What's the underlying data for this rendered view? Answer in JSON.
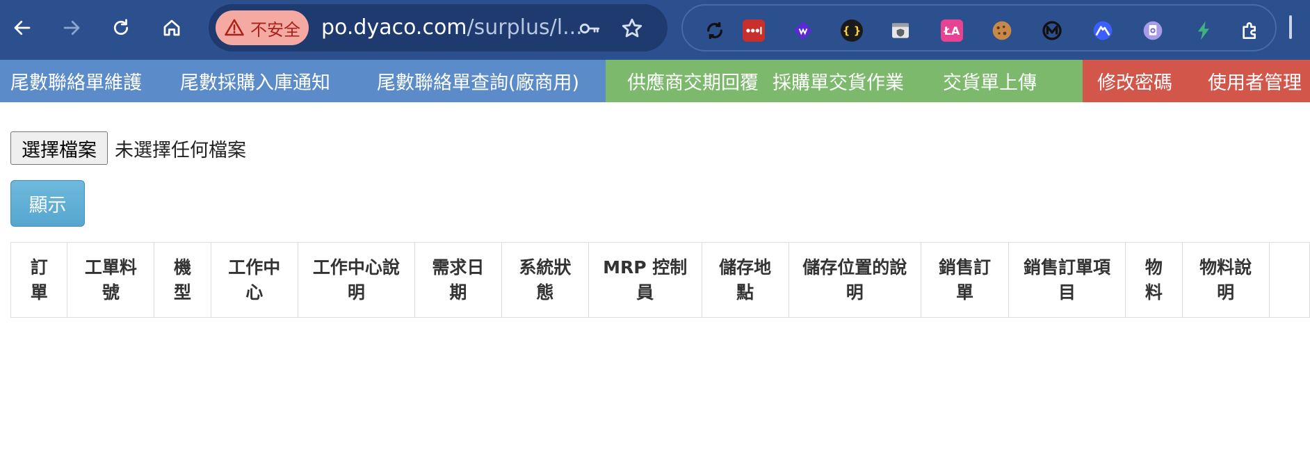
{
  "browser": {
    "security_chip": {
      "icon": "warning-triangle-icon",
      "label": "不安全"
    },
    "url": {
      "host": "po.dyaco.com",
      "path": "/surplus/l..."
    },
    "extensions": [
      "sync-icon",
      "lastpass-icon",
      "wappalyzer-icon",
      "json-viewer-icon",
      "extension-shield-icon",
      "translate-icon",
      "cookie-icon",
      "monitor-icon",
      "nordvpn-icon",
      "screenshot-icon",
      "vue-devtools-icon",
      "puzzle-icon"
    ]
  },
  "app_nav": {
    "blue": [
      "尾數聯絡單維護",
      "尾數採購入庫通知",
      "尾數聯絡單查詢(廠商用)"
    ],
    "green": [
      "供應商交期回覆",
      "採購單交貨作業",
      "交貨單上傳"
    ],
    "red": [
      "修改密碼",
      "使用者管理"
    ],
    "colors": {
      "blue": "#5b8bc9",
      "green": "#7cb96c",
      "red": "#d3564b"
    }
  },
  "upload": {
    "choose_file_label": "選擇檔案",
    "no_file_text": "未選擇任何檔案",
    "show_button_label": "顯示"
  },
  "table": {
    "columns": [
      [
        "訂",
        "單"
      ],
      [
        "工單料",
        "號"
      ],
      [
        "機",
        "型"
      ],
      [
        "工作中",
        "心"
      ],
      [
        "工作中心說",
        "明"
      ],
      [
        "需求日",
        "期"
      ],
      [
        "系統狀",
        "態"
      ],
      [
        "MRP 控制",
        "員"
      ],
      [
        "儲存地",
        "點"
      ],
      [
        "儲存位置的說",
        "明"
      ],
      [
        "銷售訂",
        "單"
      ],
      [
        "銷售訂單項",
        "目"
      ],
      [
        "物",
        "料"
      ],
      [
        "物料說",
        "明"
      ]
    ]
  }
}
